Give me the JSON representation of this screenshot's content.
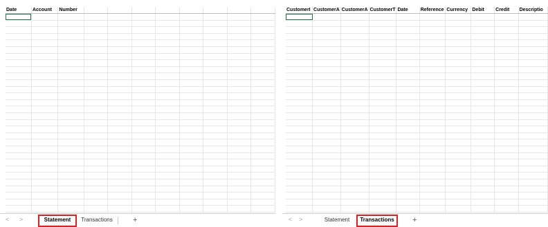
{
  "left": {
    "headers": [
      "Date",
      "Account",
      "Number",
      "",
      "",
      "",
      "",
      "",
      "",
      "",
      ""
    ],
    "sheet_tabs": [
      "Statement",
      "Transactions"
    ],
    "active_tab": "Statement",
    "add_sheet": "+",
    "nav_prev": "<",
    "nav_next": ">"
  },
  "right": {
    "headers": [
      "CustomerI",
      "CustomerA",
      "CustomerA",
      "CustomerT",
      "Date",
      "Reference",
      "Currency",
      "Debit",
      "Credit",
      "Descriptio"
    ],
    "sheet_tabs": [
      "Statement",
      "Transactions"
    ],
    "active_tab": "Transactions",
    "add_sheet": "+",
    "nav_prev": "<",
    "nav_next": ">"
  },
  "colors": {
    "selection": "#1e7145",
    "highlight": "#e02020",
    "gridline": "#e6e6e6"
  }
}
